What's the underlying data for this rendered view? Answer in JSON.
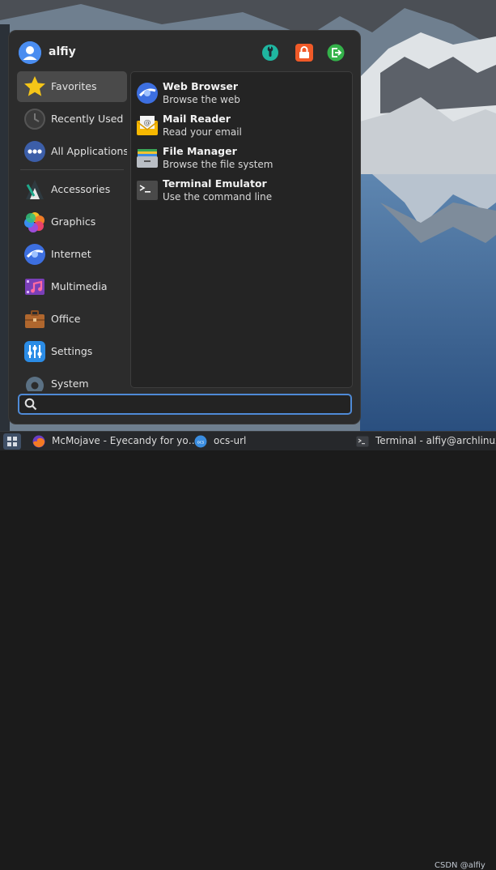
{
  "menu": {
    "username": "alfiy",
    "header_buttons": [
      "settings",
      "lock-screen",
      "log-out"
    ],
    "categories": [
      {
        "label": "Favorites",
        "icon": "star-icon",
        "active": true
      },
      {
        "label": "Recently Used",
        "icon": "clock-icon"
      },
      {
        "label": "All Applications",
        "icon": "all-apps-icon"
      },
      {
        "label": "Accessories",
        "icon": "accessories-icon"
      },
      {
        "label": "Graphics",
        "icon": "graphics-icon"
      },
      {
        "label": "Internet",
        "icon": "internet-icon"
      },
      {
        "label": "Multimedia",
        "icon": "multimedia-icon"
      },
      {
        "label": "Office",
        "icon": "office-icon"
      },
      {
        "label": "Settings",
        "icon": "settings-icon"
      },
      {
        "label": "System",
        "icon": "system-icon"
      }
    ],
    "apps": [
      {
        "name": "Web Browser",
        "description": "Browse the web",
        "icon": "web-browser-icon"
      },
      {
        "name": "Mail Reader",
        "description": "Read your email",
        "icon": "mail-reader-icon"
      },
      {
        "name": "File Manager",
        "description": "Browse the file system",
        "icon": "file-manager-icon"
      },
      {
        "name": "Terminal Emulator",
        "description": "Use the command line",
        "icon": "terminal-icon"
      }
    ],
    "search": {
      "value": "",
      "placeholder": ""
    }
  },
  "taskbar": {
    "items": [
      {
        "label": "McMojave - Eyecandy for yo…",
        "icon": "firefox-icon"
      },
      {
        "label": "ocs-url",
        "icon": "ocs-url-icon"
      },
      {
        "label": "Terminal - alfiy@archlinux:~",
        "icon": "terminal-icon"
      }
    ],
    "watermark": "CSDN @alfiy"
  },
  "colors": {
    "accent": "#4f8ad6",
    "panel": "#2c2c2c",
    "active_item": "#4a4a4a"
  }
}
